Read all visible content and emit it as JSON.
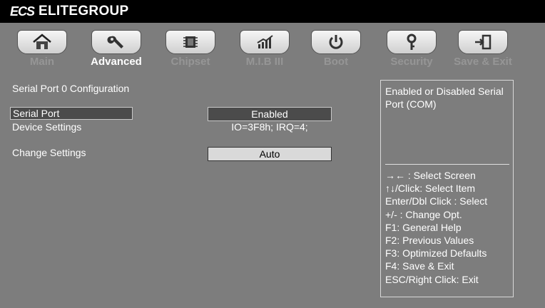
{
  "header": {
    "logo_text": "ECS",
    "brand": "ELITEGROUP"
  },
  "tabs": [
    {
      "label": "Main",
      "icon": "home-icon",
      "active": false
    },
    {
      "label": "Advanced",
      "icon": "wrench-icon",
      "active": true
    },
    {
      "label": "Chipset",
      "icon": "chip-icon",
      "active": false
    },
    {
      "label": "M.I.B III",
      "icon": "chart-icon",
      "active": false
    },
    {
      "label": "Boot",
      "icon": "power-icon",
      "active": false
    },
    {
      "label": "Security",
      "icon": "key-icon",
      "active": false
    },
    {
      "label": "Save & Exit",
      "icon": "exit-icon",
      "active": false
    }
  ],
  "main": {
    "section_title": "Serial Port 0 Configuration",
    "serial_port": {
      "label": "Serial Port",
      "value": "Enabled"
    },
    "device_settings": {
      "label": "Device Settings",
      "value": "IO=3F8h; IRQ=4;"
    },
    "change_settings": {
      "label": "Change Settings",
      "value": "Auto"
    }
  },
  "help": {
    "description": "Enabled or Disabled Serial Port (COM)",
    "keys": [
      "→←  : Select Screen",
      "↑↓/Click: Select Item",
      "Enter/Dbl Click : Select",
      "+/- : Change Opt.",
      "F1: General Help",
      "F2: Previous Values",
      "F3: Optimized Defaults",
      "F4: Save & Exit",
      "ESC/Right Click: Exit"
    ]
  }
}
